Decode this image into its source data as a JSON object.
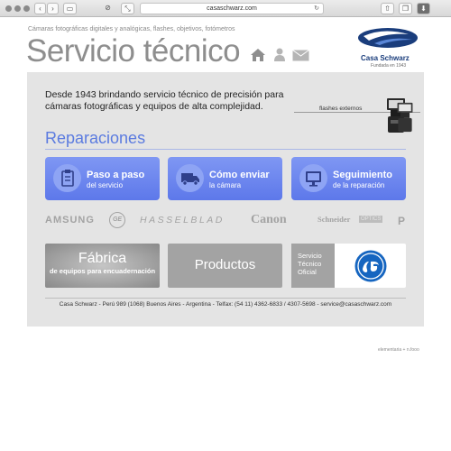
{
  "browser": {
    "url": "casaschwarz.com"
  },
  "header": {
    "tagline": "Cámaras fotográficas digitales y analógicas, flashes, objetivos, fotómetros",
    "title": "Servicio técnico",
    "icons": [
      "home-icon",
      "user-icon",
      "envelope-icon"
    ],
    "logo_name": "Casa Schwarz",
    "logo_sub": "Fundada en 1943",
    "brand_color": "#1a3d7c"
  },
  "intro": {
    "text": "Desde 1943 brindando servicio técnico de precisión para cámaras fotográficas y equipos de alta complejidad.",
    "flash_link": "flashes externos"
  },
  "reparaciones": {
    "title": "Reparaciones",
    "accent": "#5d78ea",
    "buttons": [
      {
        "title": "Paso a paso",
        "subtitle": "del servicio",
        "icon": "clipboard-icon"
      },
      {
        "title": "Cómo enviar",
        "subtitle": "la cámara",
        "icon": "truck-icon"
      },
      {
        "title": "Seguimiento",
        "subtitle": "de la reparación",
        "icon": "monitor-icon"
      }
    ]
  },
  "brands": [
    "AMSUNG",
    "GE",
    "HASSELBLAD",
    "Canon",
    "Schneider",
    "OPTICS",
    "P"
  ],
  "tiles": {
    "fabrica_title": "Fábrica",
    "fabrica_sub": "de equipos para encuadernación",
    "productos": "Productos",
    "ge_lines": [
      "Servicio",
      "Técnico",
      "Oficial"
    ]
  },
  "footer": {
    "text": "Casa Schwarz - Perú 989 (1068) Buenos Aires - Argentina - Telfax: (54 11) 4362-6833 / 4307-5698 - service@casaschwarz.com"
  },
  "credits": "elementaria + n.fooo"
}
